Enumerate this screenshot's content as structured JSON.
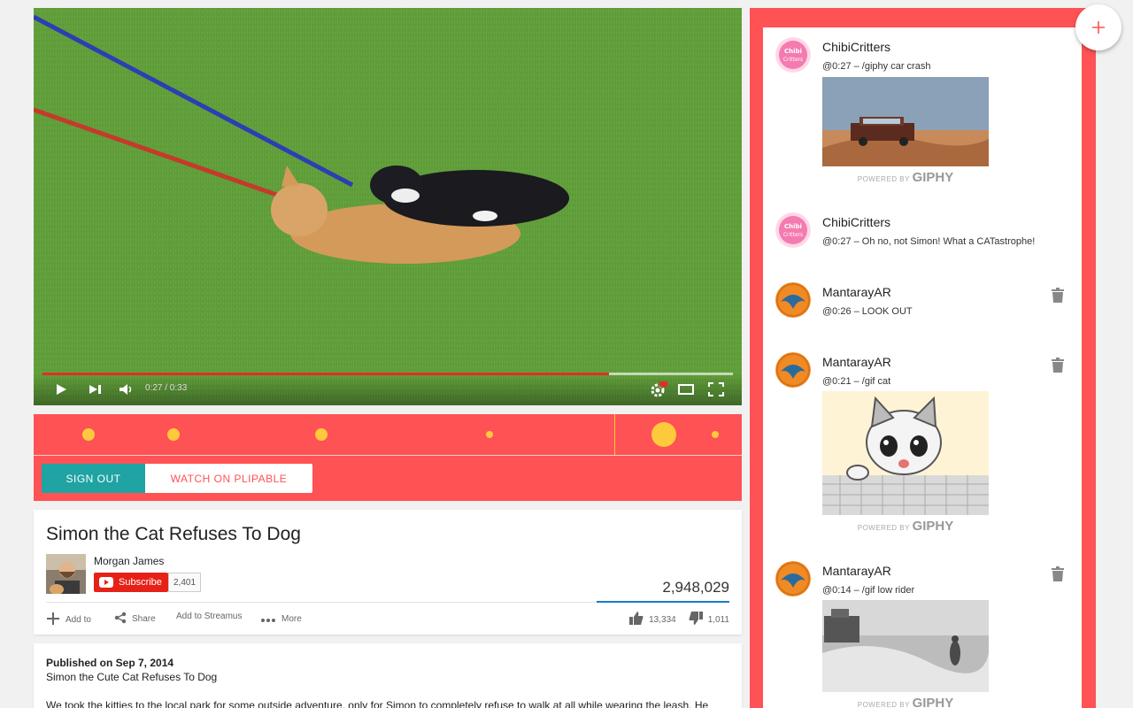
{
  "video": {
    "time": "0:27 / 0:33",
    "progress": 0.82,
    "controls": [
      "play-icon",
      "next-icon",
      "volume-icon",
      "settings-hd-icon",
      "theater-icon",
      "fullscreen-icon"
    ]
  },
  "timeline": {
    "markers": [
      0.078,
      0.198,
      0.406,
      0.644,
      0.89,
      0.963
    ],
    "playhead": 0.82
  },
  "buttons": {
    "signout": "SIGN OUT",
    "watch": "WATCH ON PLIPABLE"
  },
  "info": {
    "title": "Simon the Cat Refuses To Dog",
    "channel": "Morgan James",
    "subscribe": "Subscribe",
    "subscribers": "2,401",
    "views": "2,948,029",
    "add_to": "Add to",
    "share": "Share",
    "add_streamus": "Add to Streamus",
    "more": "More",
    "likes": "13,334",
    "dislikes": "1,011"
  },
  "description": {
    "published": "Published on Sep 7, 2014",
    "subtitle": "Simon the Cute Cat Refuses To Dog",
    "text": "We took the kitties to the local park for some outside adventure, only for Simon to completely refuse to walk at all while wearing the leash. He"
  },
  "chat": {
    "messages": [
      {
        "user": "ChibiCritters",
        "text": "@0:27 – /giphy car crash",
        "powered_by": "POWERED BY",
        "brand": "GIPHY"
      },
      {
        "user": "ChibiCritters",
        "text": "@0:27 – Oh no, not Simon! What a CATastrophe!"
      },
      {
        "user": "MantarayAR",
        "text": "@0:26 – LOOK OUT"
      },
      {
        "user": "MantarayAR",
        "text": "@0:21 – /gif cat",
        "powered_by": "POWERED BY",
        "brand": "GIPHY"
      },
      {
        "user": "MantarayAR",
        "text": "@0:14 – /gif low rider",
        "powered_by": "POWERED BY",
        "brand": "GIPHY"
      }
    ],
    "avatar_chibi_text": "Chibi Critters"
  },
  "colors": {
    "accent": "#ff5255",
    "teal": "#1fa3a3",
    "marker": "#ffc93c",
    "youtube_red": "#e62117"
  }
}
